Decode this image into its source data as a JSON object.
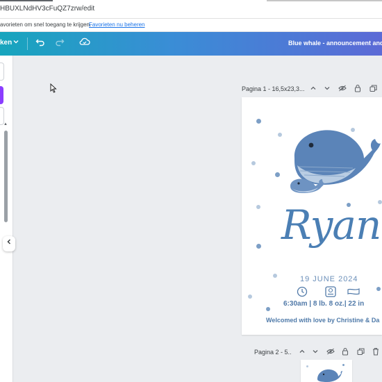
{
  "browser": {
    "url": "HBUXLNdHV3cFuQZ7zrw/edit",
    "favorites_hint": "avorieten om snel toegang te krijgen.",
    "favorites_link": "Favorieten nu beheren"
  },
  "editor": {
    "menu_label": "ken",
    "document_title": "Blue whale - announcement and"
  },
  "pages": [
    {
      "header": "Pagina 1 - 16,5x23,3..."
    },
    {
      "header": "Pagina 2 - 5.."
    }
  ],
  "card": {
    "name": "Ryan",
    "date": "19 JUNE 2024",
    "stats": "6:30am | 8 lb. 8 oz.| 22 in",
    "welcome": "Welcomed with love by Christine & Da"
  },
  "colors": {
    "accent": "#8b3dff",
    "whale_blue": "#4b7fb4"
  }
}
